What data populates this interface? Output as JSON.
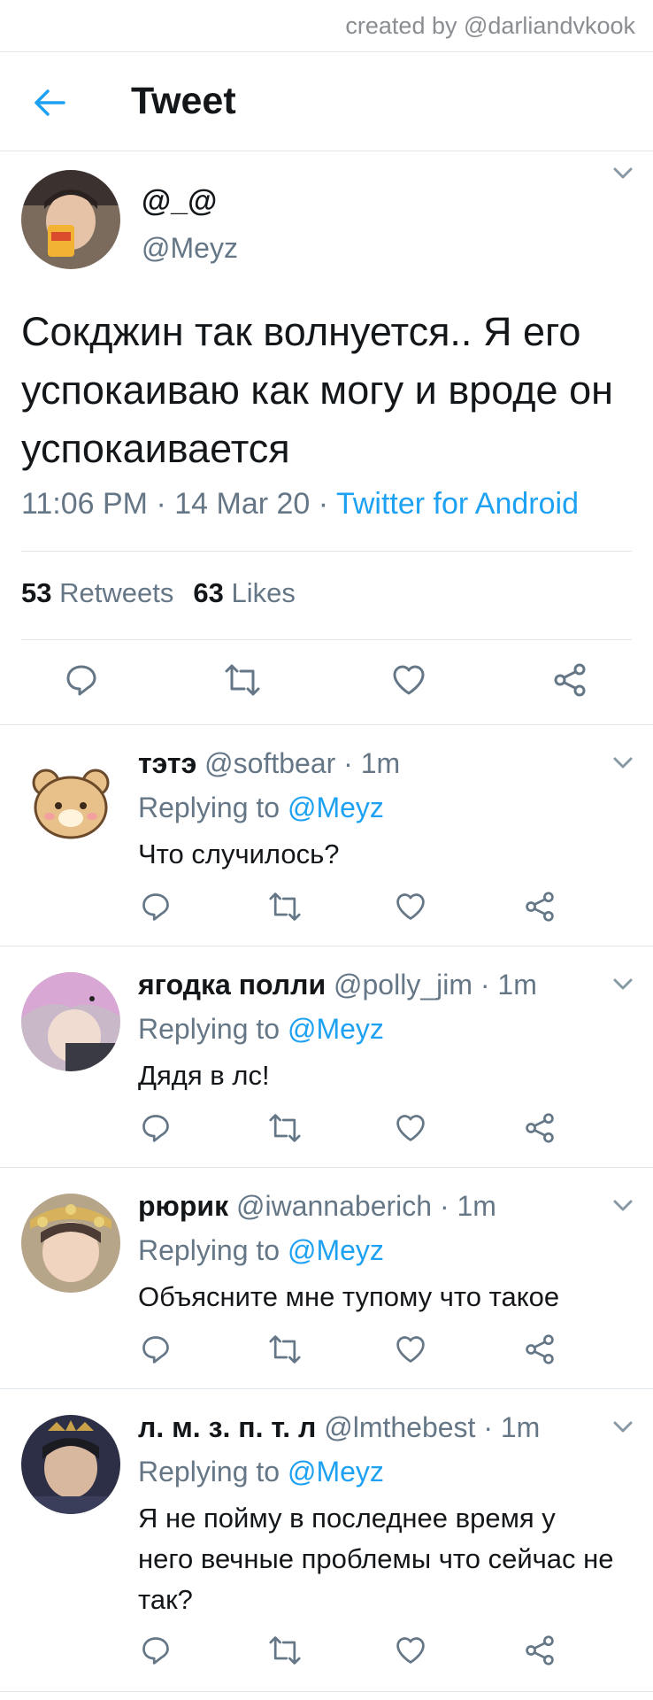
{
  "credit": "created by @darliandvkook",
  "header": {
    "title": "Tweet"
  },
  "tweet": {
    "name": "@_@",
    "handle": "@Meyz",
    "text": "Сокджин так волнуется.. Я его успокаиваю как могу и вроде он успокаивается",
    "time": "11:06 PM",
    "date": "14 Mar 20",
    "source": "Twitter for Android",
    "sep": "·",
    "retweets_count": "53",
    "retweets_label": "Retweets",
    "likes_count": "63",
    "likes_label": "Likes"
  },
  "replies": [
    {
      "name": "тэтэ",
      "handle": "@softbear",
      "time": "· 1m",
      "replying": "Replying to",
      "mention": "@Meyz",
      "text": "Что случилось?"
    },
    {
      "name": "ягодка полли",
      "handle": "@polly_jim",
      "time": "· 1m",
      "replying": "Replying to",
      "mention": "@Meyz",
      "text": "Дядя в лс!"
    },
    {
      "name": "рюрик",
      "handle": "@iwannaberich",
      "time": "· 1m",
      "replying": "Replying to",
      "mention": "@Meyz",
      "text": "Объясните мне тупому что такое"
    },
    {
      "name": "л. м. з. п. т. л",
      "handle": "@lmthebest",
      "time": "· 1m",
      "replying": "Replying to",
      "mention": "@Meyz",
      "text": "Я не пойму в последнее время у него вечные проблемы что сейчас не так?"
    }
  ],
  "colors": {
    "accent": "#1da1f2",
    "secondary_text": "#657786",
    "divider": "#e1e8ed"
  },
  "icons": [
    "back-arrow-icon",
    "chevron-down-icon",
    "reply-icon",
    "retweet-icon",
    "like-icon",
    "share-icon"
  ]
}
